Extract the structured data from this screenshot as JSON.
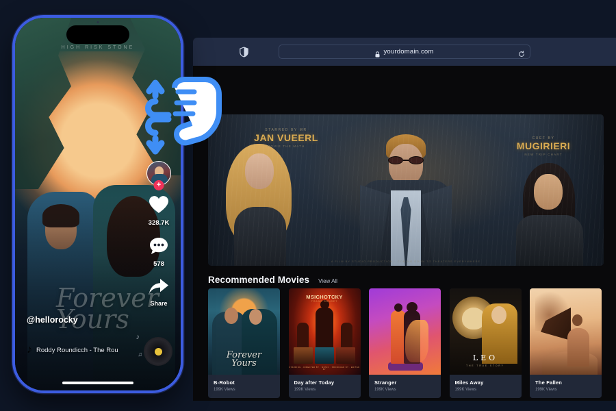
{
  "browser": {
    "url": "yourdomain.com",
    "shield_icon": "shield-half-icon",
    "lock_icon": "lock-icon",
    "reload_icon": "reload-icon"
  },
  "hero": {
    "left_poster": {
      "eyebrow": "STARRED BY MR",
      "title": "JAN VUEERL",
      "sub": "MOVIE THE MATH"
    },
    "right_poster": {
      "eyebrow": "CUEF BY",
      "title": "MUGIRIERI",
      "sub": "NEW TRIP CHART"
    },
    "footer_credits": "A FILM BY STUDIO PRODUCTION  ·  COMING SOON TO THEATERS EVERYWHERE"
  },
  "recommended": {
    "title": "Recommended Movies",
    "view_all": "View All",
    "cards": [
      {
        "title": "B-Robot",
        "views": "199K Views",
        "art": "forever-yours-poster",
        "art_title": "Forever",
        "art_title2": "Yours"
      },
      {
        "title": "Day after Today",
        "views": "199K Views",
        "art": "msichotcky-poster",
        "art_title": "MSICHOTCKY",
        "art_sub": "TRANS SUNSET",
        "art_credits": "STARRING · DIRECTED BY · MUSIC · PRODUCED BY · EDITED BY"
      },
      {
        "title": "Stranger",
        "views": "199K Views",
        "art": "dancing-couple-poster"
      },
      {
        "title": "Miles Away",
        "views": "199K Views",
        "art": "leo-lion-poster",
        "art_title": "LEO",
        "art_sub": "THE TRUE STORY"
      },
      {
        "title": "The Fallen",
        "views": "199K Views",
        "art": "winged-angel-poster"
      }
    ]
  },
  "phone": {
    "poster_caption": "HIGH RISK STONE",
    "script_title": "Forever",
    "script_title2": "Yours",
    "username": "@hellorocky",
    "music": {
      "note_icon": "music-note-icon",
      "track": "Roddy Roundicch - The Rou",
      "disc_icon": "vinyl-record-icon"
    },
    "rail": {
      "avatar_icon": "avatar",
      "follow_label": "+",
      "like_icon": "heart-icon",
      "likes": "328.7K",
      "comment_icon": "comment-icon",
      "comments": "578",
      "share_icon": "share-arrow-icon",
      "share_label": "Share"
    },
    "home_indicator": "home-indicator"
  },
  "gesture": {
    "icon": "scroll-hand-cursor-icon",
    "accent_color": "#3f8ef5"
  },
  "colors": {
    "page_bg": "#0e1626",
    "browser_chrome": "#222c44",
    "viewport_bg": "#09090b",
    "phone_frame": "#3c5ce0",
    "follow_red": "#f0325a",
    "gold": "#d9ab52"
  }
}
